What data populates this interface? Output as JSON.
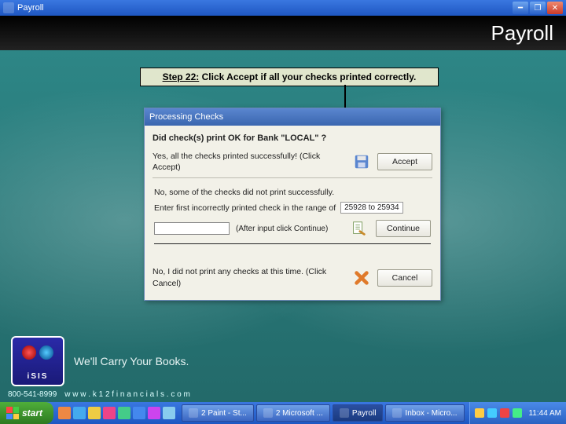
{
  "app": {
    "title": "Payroll",
    "header_title": "Payroll"
  },
  "callout": {
    "step_label": "Step 22:",
    "text": " Click Accept if all your checks printed correctly."
  },
  "dialog": {
    "title": "Processing Checks",
    "question": "Did check(s) print OK for Bank \"LOCAL\" ?",
    "yes_text": "Yes, all the checks printed successfully! (Click Accept)",
    "accept_label": "Accept",
    "no_some_text": "No, some of the checks did not print successfully.",
    "enter_range_text": "Enter first incorrectly printed check in the range of",
    "range": "25928 to 25934",
    "after_input": "(After input click Continue)",
    "continue_label": "Continue",
    "no_none_text": "No, I did not print any checks at this time. (Click Cancel)",
    "cancel_label": "Cancel"
  },
  "branding": {
    "logo_text": "iSIS",
    "tagline": "We'll Carry Your Books.",
    "phone": "800-541-8999",
    "url": "w w w . k 1 2 f i n a n c i a l s . c o m"
  },
  "taskbar": {
    "start": "start",
    "tasks": [
      "2 Paint - St...",
      "2 Microsoft ...",
      "Payroll",
      "Inbox - Micro..."
    ],
    "clock": "11:44 AM"
  }
}
